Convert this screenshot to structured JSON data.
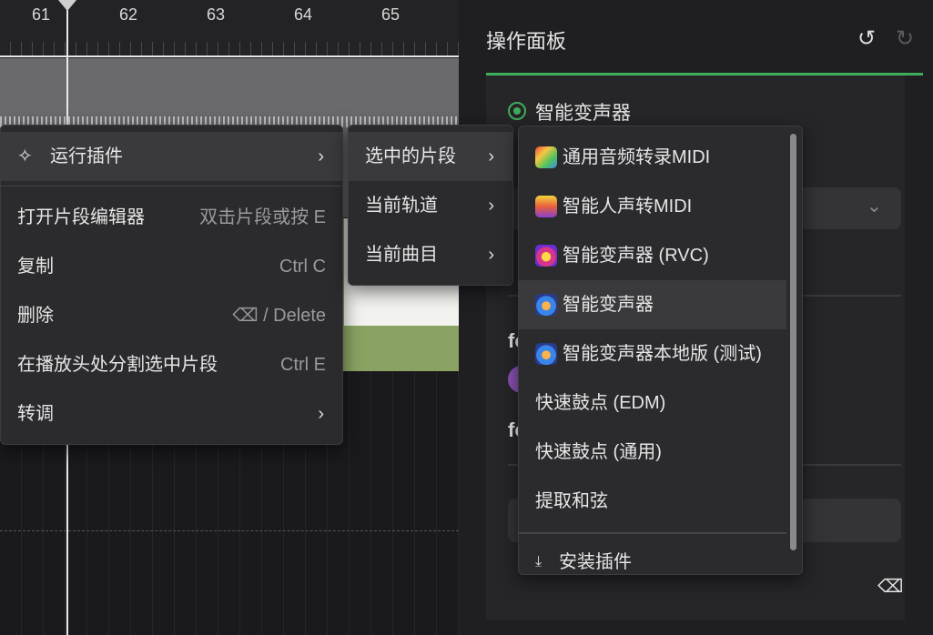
{
  "timeline": {
    "ruler_numbers": [
      "61",
      "62",
      "63",
      "64",
      "65"
    ]
  },
  "panel": {
    "title": "操作面板",
    "undo_icon": "undo-icon",
    "redo_icon": "redo-icon",
    "selected_plugin": "智能变声器",
    "partial_label_1": "fo",
    "partial_label_2": "fo",
    "eraser_icon": "eraser-icon",
    "accent_color": "#3fae5a"
  },
  "menu_main": {
    "items": [
      {
        "label": "运行插件",
        "shortcut": "",
        "icon": "magic-wand-icon",
        "submenu": true
      },
      {
        "label": "打开片段编辑器",
        "shortcut": "双击片段或按 E"
      },
      {
        "label": "复制",
        "shortcut": "Ctrl C"
      },
      {
        "label": "删除",
        "shortcut": "⌫ / Delete"
      },
      {
        "label": "在播放头处分割选中片段",
        "shortcut": "Ctrl E"
      },
      {
        "label": "转调",
        "shortcut": "",
        "submenu": true
      }
    ]
  },
  "menu_scope": {
    "items": [
      {
        "label": "选中的片段",
        "submenu": true
      },
      {
        "label": "当前轨道",
        "submenu": true
      },
      {
        "label": "当前曲目",
        "submenu": true
      }
    ]
  },
  "menu_plugins": {
    "items": [
      {
        "label": "通用音频转录MIDI",
        "icon": "audio-to-midi-icon"
      },
      {
        "label": "智能人声转MIDI",
        "icon": "voice-to-midi-icon"
      },
      {
        "label": "智能变声器 (RVC)",
        "icon": "rvc-voice-changer-icon"
      },
      {
        "label": "智能变声器",
        "icon": "voice-changer-icon"
      },
      {
        "label": "智能变声器本地版 (测试)",
        "icon": "local-voice-changer-icon"
      },
      {
        "label": "快速鼓点 (EDM)"
      },
      {
        "label": "快速鼓点 (通用)"
      },
      {
        "label": "提取和弦"
      }
    ],
    "install_label": "安装插件"
  }
}
